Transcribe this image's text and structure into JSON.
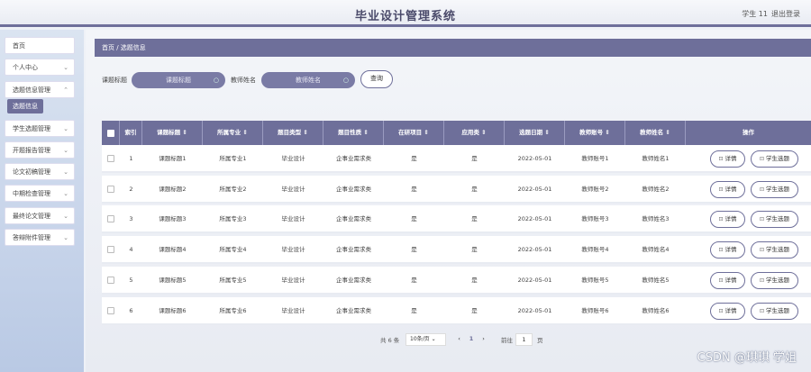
{
  "header": {
    "title": "毕业设计管理系统",
    "user": "学生 11",
    "logout": "退出登录"
  },
  "sidebar": {
    "items": [
      {
        "label": "首页",
        "chev": ""
      },
      {
        "label": "个人中心",
        "chev": "⌄"
      },
      {
        "label": "选题信息管理",
        "chev": "⌃"
      },
      {
        "label": "学生选题管理",
        "chev": "⌄"
      },
      {
        "label": "开题报告管理",
        "chev": "⌄"
      },
      {
        "label": "论文初稿管理",
        "chev": "⌄"
      },
      {
        "label": "中期检查管理",
        "chev": "⌄"
      },
      {
        "label": "最终论文管理",
        "chev": "⌄"
      },
      {
        "label": "答辩附件管理",
        "chev": "⌄"
      }
    ],
    "sub_active": "选题信息"
  },
  "breadcrumb": "首页 / 选题信息",
  "search": {
    "label1": "课题标题",
    "placeholder1": "课题标题",
    "label2": "教师姓名",
    "placeholder2": "教师姓名",
    "query_button": "查询"
  },
  "table": {
    "headers": [
      "索引",
      "课题标题 ⇕",
      "所属专业 ⇕",
      "题目类型 ⇕",
      "题目性质 ⇕",
      "在研项目 ⇕",
      "应用类 ⇕",
      "选题日期 ⇕",
      "教师账号 ⇕",
      "教师姓名 ⇕",
      "操作"
    ],
    "rows": [
      {
        "idx": "1",
        "title": "课题标题1",
        "major": "所属专业1",
        "type": "毕业设计",
        "nature": "企事业需求类",
        "research": "是",
        "applied": "是",
        "date": "2022-05-01",
        "account": "教师账号1",
        "teacher": "教师姓名1"
      },
      {
        "idx": "2",
        "title": "课题标题2",
        "major": "所属专业2",
        "type": "毕业设计",
        "nature": "企事业需求类",
        "research": "是",
        "applied": "是",
        "date": "2022-05-01",
        "account": "教师账号2",
        "teacher": "教师姓名2"
      },
      {
        "idx": "3",
        "title": "课题标题3",
        "major": "所属专业3",
        "type": "毕业设计",
        "nature": "企事业需求类",
        "research": "是",
        "applied": "是",
        "date": "2022-05-01",
        "account": "教师账号3",
        "teacher": "教师姓名3"
      },
      {
        "idx": "4",
        "title": "课题标题4",
        "major": "所属专业4",
        "type": "毕业设计",
        "nature": "企事业需求类",
        "research": "是",
        "applied": "是",
        "date": "2022-05-01",
        "account": "教师账号4",
        "teacher": "教师姓名4"
      },
      {
        "idx": "5",
        "title": "课题标题5",
        "major": "所属专业5",
        "type": "毕业设计",
        "nature": "企事业需求类",
        "research": "是",
        "applied": "是",
        "date": "2022-05-01",
        "account": "教师账号5",
        "teacher": "教师姓名5"
      },
      {
        "idx": "6",
        "title": "课题标题6",
        "major": "所属专业6",
        "type": "毕业设计",
        "nature": "企事业需求类",
        "research": "是",
        "applied": "是",
        "date": "2022-05-01",
        "account": "教师账号6",
        "teacher": "教师姓名6"
      }
    ],
    "detail_btn": "详情",
    "select_btn": "学生选题"
  },
  "pager": {
    "total": "共 6 条",
    "page_size": "10条/页",
    "prev": "‹",
    "current": "1",
    "next": "›",
    "goto": "前往",
    "goto_value": "1",
    "page_unit": "页"
  },
  "watermark": "CSDN @琪琪 学姐",
  "colors": {
    "accent": "#6e6f9a",
    "pill": "#7a7ba5"
  }
}
